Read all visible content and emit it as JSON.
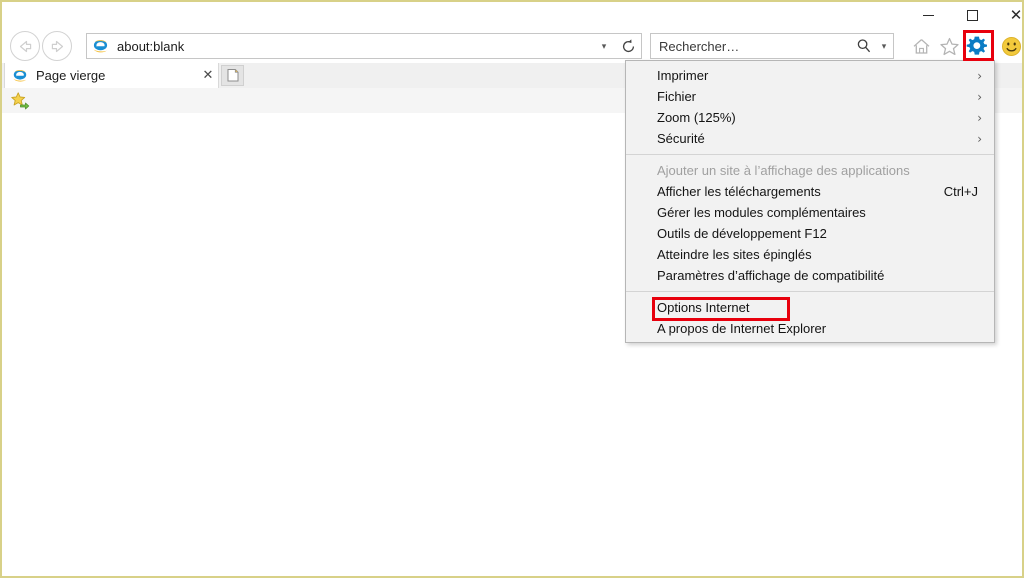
{
  "window": {
    "controls": {
      "minimize_label": "Minimiser",
      "maximize_label": "Agrandir",
      "close_label": "Fermer",
      "close_glyph": "✕"
    },
    "border_color": "#d8d188"
  },
  "navigation": {
    "back_label": "Page précédente",
    "forward_label": "Page suivante",
    "address_value": "about:blank",
    "address_dropdown_glyph": "▾",
    "refresh_label": "Actualiser"
  },
  "search": {
    "placeholder": "Rechercher…",
    "caret_glyph": "▾"
  },
  "toolbar": {
    "home_label": "Accueil",
    "favorites_label": "Favoris",
    "tools_label": "Outils",
    "feedback_label": "Envoyer des commentaires",
    "highlight_color": "#e8000d",
    "gear_color": "#0078d7"
  },
  "tab": {
    "title": "Page vierge",
    "close_glyph": "✕",
    "newtab_label": "Nouvel onglet"
  },
  "favorites_bar": {
    "add_label": "Ajouter aux favoris"
  },
  "menu": {
    "items": [
      {
        "label": "Imprimer",
        "shortcut": "",
        "arrow": "›",
        "disabled": false,
        "separator_after": false
      },
      {
        "label": "Fichier",
        "shortcut": "",
        "arrow": "›",
        "disabled": false,
        "separator_after": false
      },
      {
        "label": "Zoom (125%)",
        "shortcut": "",
        "arrow": "›",
        "disabled": false,
        "separator_after": false
      },
      {
        "label": "Sécurité",
        "shortcut": "",
        "arrow": "›",
        "disabled": false,
        "separator_after": true
      },
      {
        "label": "Ajouter un site à l’affichage des applications",
        "shortcut": "",
        "arrow": "",
        "disabled": true,
        "separator_after": false
      },
      {
        "label": "Afficher les téléchargements",
        "shortcut": "Ctrl+J",
        "arrow": "",
        "disabled": false,
        "separator_after": false
      },
      {
        "label": "Gérer les modules complémentaires",
        "shortcut": "",
        "arrow": "",
        "disabled": false,
        "separator_after": false
      },
      {
        "label": "Outils de développement F12",
        "shortcut": "",
        "arrow": "",
        "disabled": false,
        "separator_after": false
      },
      {
        "label": "Atteindre les sites épinglés",
        "shortcut": "",
        "arrow": "",
        "disabled": false,
        "separator_after": false
      },
      {
        "label": "Paramètres d’affichage de compatibilité",
        "shortcut": "",
        "arrow": "",
        "disabled": false,
        "separator_after": true
      },
      {
        "label": "Options Internet",
        "shortcut": "",
        "arrow": "",
        "disabled": false,
        "separator_after": false
      },
      {
        "label": "A propos de Internet Explorer",
        "shortcut": "",
        "arrow": "",
        "disabled": false,
        "separator_after": false
      }
    ],
    "highlighted_item": "Options Internet"
  }
}
